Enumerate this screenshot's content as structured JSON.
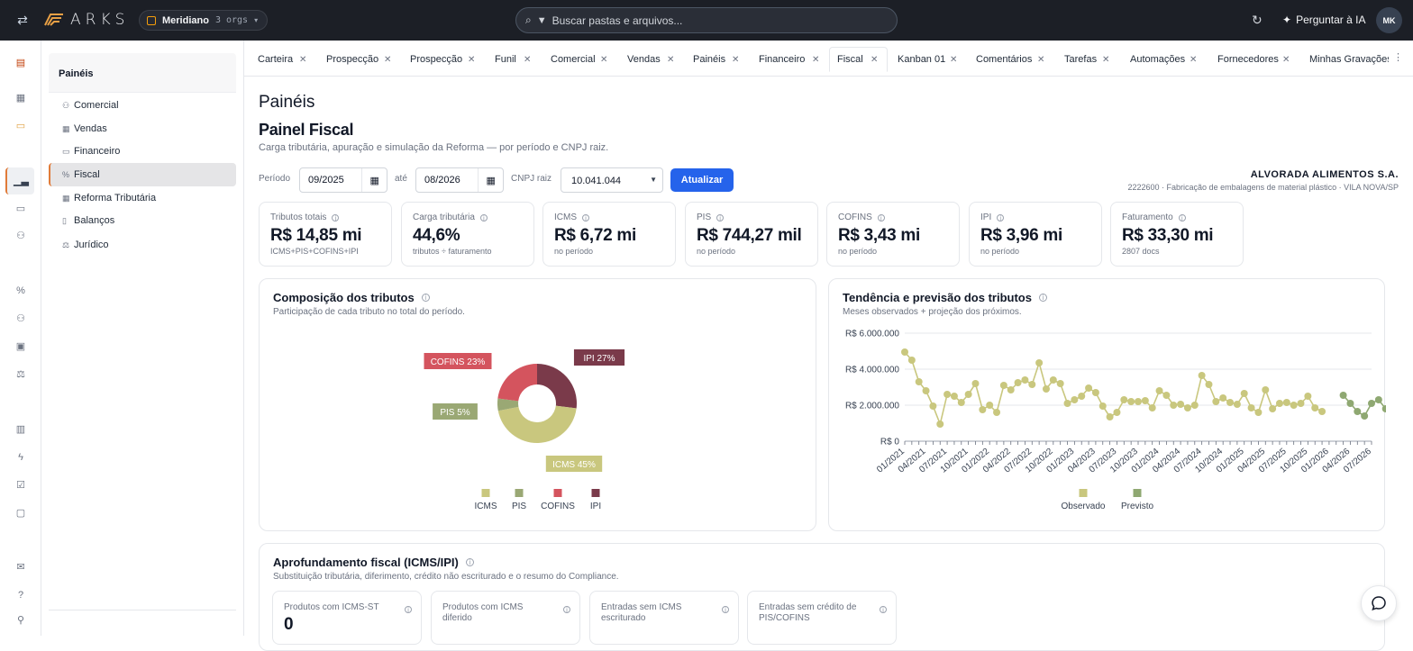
{
  "app": {
    "brand": "ARKS",
    "org_name": "Meridiano",
    "org_count": "3 orgs",
    "search_placeholder": "Buscar pastas e arquivos...",
    "ask_ai": "Perguntar à IA",
    "avatar_initials": "MK"
  },
  "sidebar": {
    "title": "Painéis",
    "items": [
      {
        "label": "Comercial",
        "icon": "users-icon"
      },
      {
        "label": "Vendas",
        "icon": "table-icon"
      },
      {
        "label": "Financeiro",
        "icon": "wallet-icon"
      },
      {
        "label": "Fiscal",
        "icon": "percent-icon"
      },
      {
        "label": "Reforma Tributária",
        "icon": "grid-icon"
      },
      {
        "label": "Balanços",
        "icon": "file-icon"
      },
      {
        "label": "Jurídico",
        "icon": "scale-icon"
      }
    ]
  },
  "tabs": [
    "Carteira",
    "Prospecção",
    "Prospecção",
    "Funil",
    "Comercial",
    "Vendas",
    "Painéis",
    "Financeiro",
    "Fiscal",
    "Kanban 01",
    "Comentários",
    "Tarefas",
    "Automações",
    "Fornecedores",
    "Minhas Gravações"
  ],
  "page": {
    "title": "Painéis",
    "panel_title": "Painel Fiscal",
    "panel_subtitle": "Carga tributária, apuração e simulação da Reforma — por período e CNPJ raiz."
  },
  "filters": {
    "period_label": "Período",
    "from": "09/2025",
    "until_label": "até",
    "to": "08/2026",
    "cnpj_label": "CNPJ raiz",
    "cnpj_value": "10.041.044",
    "update_button": "Atualizar"
  },
  "company": {
    "name": "ALVORADA ALIMENTOS S.A.",
    "description": "2222600 · Fabricação de embalagens de material plástico · VILA NOVA/SP"
  },
  "kpis": [
    {
      "label": "Tributos totais",
      "value": "R$ 14,85 mi",
      "sub": "ICMS+PIS+COFINS+IPI"
    },
    {
      "label": "Carga tributária",
      "value": "44,6%",
      "sub": "tributos ÷ faturamento"
    },
    {
      "label": "ICMS",
      "value": "R$ 6,72 mi",
      "sub": "no período"
    },
    {
      "label": "PIS",
      "value": "R$ 744,27 mil",
      "sub": "no período"
    },
    {
      "label": "COFINS",
      "value": "R$ 3,43 mi",
      "sub": "no período"
    },
    {
      "label": "IPI",
      "value": "R$ 3,96 mi",
      "sub": "no período"
    },
    {
      "label": "Faturamento",
      "value": "R$ 33,30 mi",
      "sub": "2807 docs"
    }
  ],
  "composition": {
    "title": "Composição dos tributos",
    "subtitle": "Participação de cada tributo no total do período."
  },
  "trend": {
    "title": "Tendência e previsão dos tributos",
    "subtitle": "Meses observados + projeção dos próximos."
  },
  "deep": {
    "title": "Aprofundamento fiscal (ICMS/IPI)",
    "subtitle": "Substituição tributária, diferimento, crédito não escriturado e o resumo do Compliance.",
    "kpis": [
      {
        "label": "Produtos com ICMS-ST",
        "value": "0"
      },
      {
        "label": "Produtos com ICMS diferido",
        "value": ""
      },
      {
        "label": "Entradas sem ICMS escriturado",
        "value": ""
      },
      {
        "label": "Entradas sem crédito de PIS/COFINS",
        "value": ""
      }
    ]
  },
  "chart_data": [
    {
      "type": "pie",
      "categories": [
        "ICMS",
        "PIS",
        "COFINS",
        "IPI"
      ],
      "values": [
        45,
        5,
        23,
        27
      ],
      "labels": [
        "ICMS 45%",
        "PIS 5%",
        "COFINS 23%",
        "IPI 27%"
      ],
      "colors": [
        "#c9c77e",
        "#9aa874",
        "#d4545e",
        "#7a3a4a"
      ],
      "legend": "bottom"
    },
    {
      "type": "line",
      "ylim": [
        0,
        6000000
      ],
      "yticks": [
        "R$ 0",
        "R$ 2.000.000",
        "R$ 4.000.000",
        "R$ 6.000.000"
      ],
      "xticks": [
        "01/2021",
        "04/2021",
        "07/2021",
        "10/2021",
        "01/2022",
        "04/2022",
        "07/2022",
        "10/2022",
        "01/2023",
        "04/2023",
        "07/2023",
        "10/2023",
        "01/2024",
        "04/2024",
        "07/2024",
        "10/2024",
        "01/2025",
        "04/2025",
        "07/2025",
        "10/2025",
        "01/2026",
        "04/2026",
        "07/2026"
      ],
      "legend": "bottom",
      "series": [
        {
          "name": "Observado",
          "color": "#c9c77e",
          "values": [
            4950000,
            4500000,
            3300000,
            2800000,
            1950000,
            950000,
            2600000,
            2500000,
            2150000,
            2600000,
            3200000,
            1750000,
            2000000,
            1600000,
            3100000,
            2850000,
            3250000,
            3400000,
            3150000,
            4350000,
            2900000,
            3400000,
            3200000,
            2100000,
            2300000,
            2500000,
            2950000,
            2700000,
            1950000,
            1350000,
            1600000,
            2300000,
            2200000,
            2200000,
            2250000,
            1850000,
            2800000,
            2550000,
            2000000,
            2050000,
            1850000,
            2000000,
            3650000,
            3150000,
            2200000,
            2400000,
            2150000,
            2050000,
            2650000,
            1850000,
            1600000,
            2850000,
            1800000,
            2100000,
            2150000,
            2000000,
            2100000,
            2500000,
            1850000,
            1650000
          ],
          "x_start": "01/2021"
        },
        {
          "name": "Previsto",
          "color": "#8fa872",
          "values": [
            2550000,
            2100000,
            1650000,
            1400000,
            2100000,
            2300000,
            1800000
          ],
          "x_start": "03/2026"
        }
      ]
    }
  ]
}
